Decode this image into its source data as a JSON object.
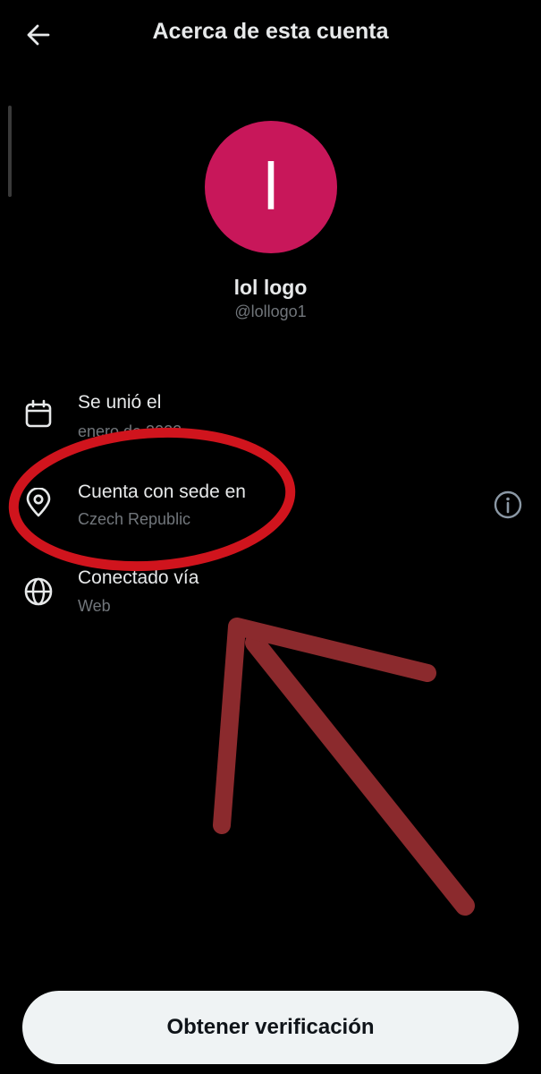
{
  "header": {
    "title": "Acerca de esta cuenta",
    "back_icon": "arrow-left-icon"
  },
  "profile": {
    "avatar_letter": "l",
    "avatar_color": "#c8175a",
    "name": "lol logo",
    "handle": "@lollogo1"
  },
  "details": [
    {
      "icon": "calendar-icon",
      "title": "Se unió el",
      "value": "enero de 2022"
    },
    {
      "icon": "location-pin-icon",
      "title": "Cuenta con sede en",
      "value": "Czech Republic"
    },
    {
      "icon": "globe-icon",
      "title": "Conectado vía",
      "value": "Web"
    }
  ],
  "annotation": {
    "circle_color": "#d0141d",
    "arrow_color": "#8b2a2d"
  },
  "footer": {
    "button_label": "Obtener verificación"
  }
}
